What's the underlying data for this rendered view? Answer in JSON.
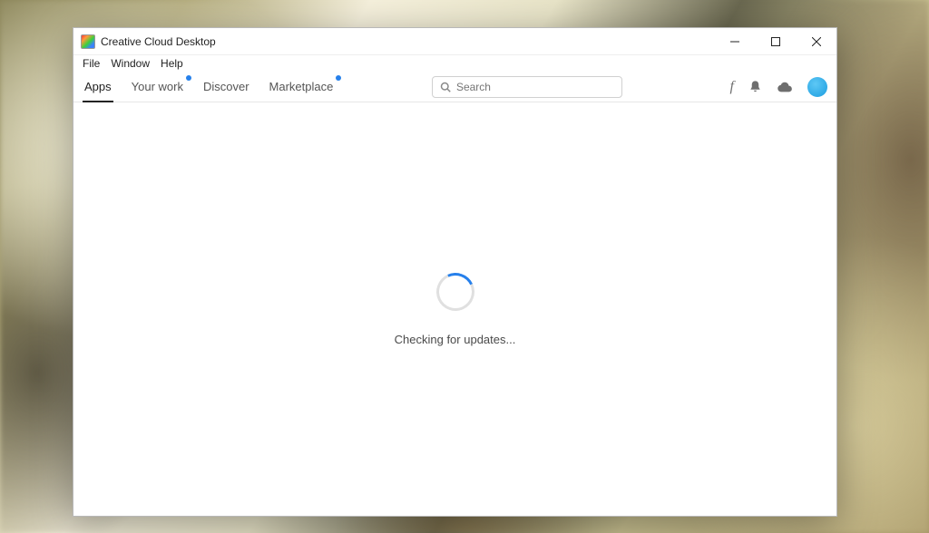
{
  "window": {
    "title": "Creative Cloud Desktop"
  },
  "menu": {
    "file": "File",
    "window": "Window",
    "help": "Help"
  },
  "tabs": {
    "apps": "Apps",
    "your_work": "Your work",
    "discover": "Discover",
    "marketplace": "Marketplace"
  },
  "search": {
    "placeholder": "Search"
  },
  "content": {
    "status": "Checking for updates..."
  },
  "icons": {
    "fonts": "f",
    "bell": "bell-icon",
    "cloud": "cloud-icon",
    "avatar": "user-avatar"
  }
}
